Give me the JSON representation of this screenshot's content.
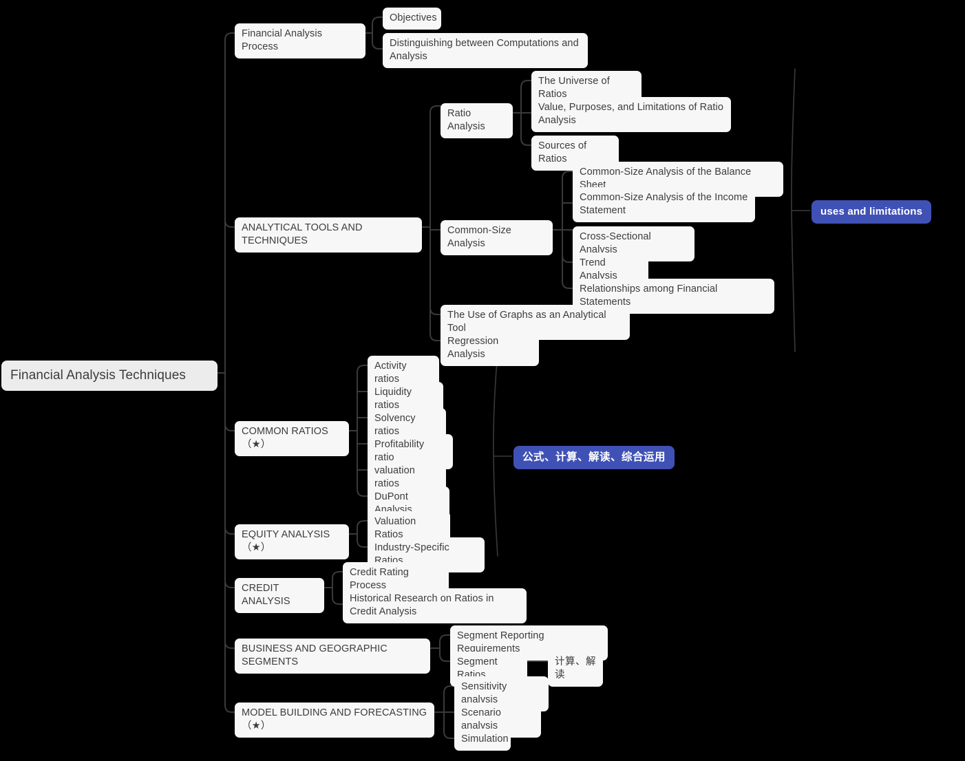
{
  "diagram": {
    "type": "mindmap",
    "title": "Financial Analysis Techniques",
    "background_color": "#000000",
    "node_color": "#f7f7f7",
    "root_color": "#ececec",
    "badge_color": "#4051b5",
    "text_color": "#3c3c3c"
  },
  "root": {
    "label": "Financial Analysis Techniques"
  },
  "branches": [
    {
      "label": "Financial Analysis Process",
      "children": [
        {
          "label": "Objectives"
        },
        {
          "label": "Distinguishing between Computations and Analysis"
        }
      ]
    },
    {
      "label": "ANALYTICAL TOOLS AND TECHNIQUES",
      "children": [
        {
          "label": "Ratio Analysis",
          "children": [
            {
              "label": "The Universe of Ratios"
            },
            {
              "label": "Value, Purposes, and Limitations of Ratio Analysis"
            },
            {
              "label": "Sources of Ratios"
            }
          ]
        },
        {
          "label": "Common-Size Analysis",
          "children": [
            {
              "label": "Common-Size Analysis of the Balance Sheet"
            },
            {
              "label": "Common-Size Analysis of the Income Statement"
            },
            {
              "label": "Cross-Sectional Analysis"
            },
            {
              "label": "Trend Analysis"
            },
            {
              "label": "Relationships among Financial Statements"
            }
          ]
        },
        {
          "label": "The Use of Graphs as an Analytical Tool"
        },
        {
          "label": "Regression Analysis"
        }
      ]
    },
    {
      "label": "COMMON RATIOS（★）",
      "children": [
        {
          "label": "Activity ratios"
        },
        {
          "label": "Liquidity ratios"
        },
        {
          "label": "Solvency ratios"
        },
        {
          "label": "Profitability ratio"
        },
        {
          "label": "valuation ratios"
        },
        {
          "label": "DuPont Analysis"
        }
      ]
    },
    {
      "label": "EQUITY ANALYSIS（★）",
      "children": [
        {
          "label": "Valuation Ratios"
        },
        {
          "label": "Industry-Specific Ratios"
        }
      ]
    },
    {
      "label": "CREDIT ANALYSIS",
      "children": [
        {
          "label": "Credit Rating Process"
        },
        {
          "label": "Historical Research on Ratios in Credit Analysis"
        }
      ]
    },
    {
      "label": "BUSINESS AND GEOGRAPHIC SEGMENTS",
      "children": [
        {
          "label": "Segment Reporting Requirements"
        },
        {
          "label": "Segment Ratios",
          "children": [
            {
              "label": "计算、解读"
            }
          ]
        }
      ]
    },
    {
      "label": "MODEL BUILDING AND FORECASTING（★）",
      "children": [
        {
          "label": "Sensitivity analysis"
        },
        {
          "label": "Scenario analysis"
        },
        {
          "label": "Simulation"
        }
      ]
    }
  ],
  "annotations": [
    {
      "label": "uses and limitations",
      "scope": "ANALYTICAL TOOLS AND TECHNIQUES subtree"
    },
    {
      "label": "公式、计算、解读、综合运用",
      "scope": "COMMON RATIOS and EQUITY ANALYSIS subtrees"
    }
  ]
}
